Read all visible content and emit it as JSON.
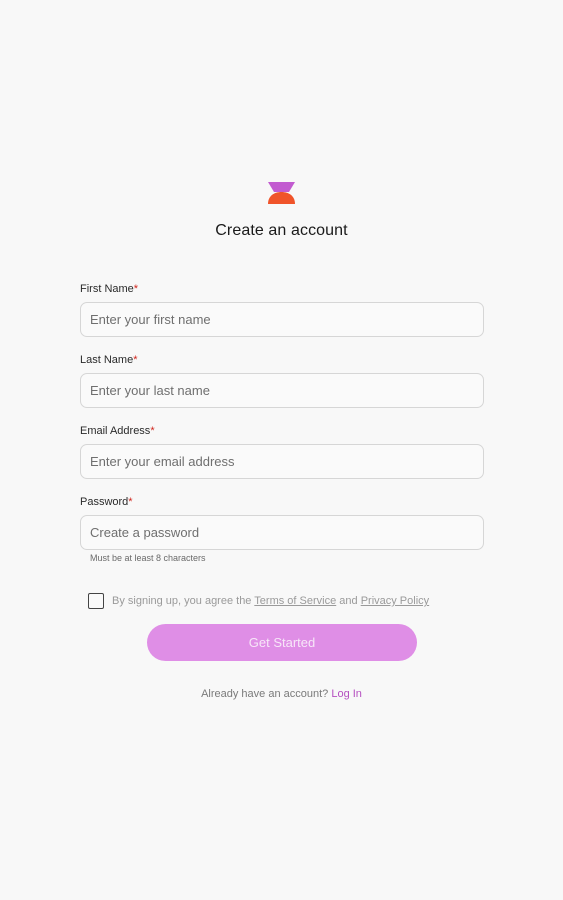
{
  "header": {
    "title": "Create an account"
  },
  "colors": {
    "logo_top": "#c25bd0",
    "logo_bottom": "#f0542a",
    "button_bg": "#df8ee6",
    "link": "#b54fc0",
    "required_asterisk": "#d0261d"
  },
  "form": {
    "first_name": {
      "label": "First Name",
      "required": "*",
      "placeholder": "Enter your first name"
    },
    "last_name": {
      "label": "Last Name",
      "required": "*",
      "placeholder": "Enter your last name"
    },
    "email": {
      "label": "Email Address",
      "required": "*",
      "placeholder": "Enter your email address"
    },
    "password": {
      "label": "Password",
      "required": "*",
      "placeholder": "Create a password",
      "hint": "Must be at least 8 characters"
    },
    "agree": {
      "prefix": "By signing up, you agree the ",
      "terms_link": "Terms of Service",
      "middle": " and ",
      "privacy_link": "Privacy Policy"
    },
    "submit_label": "Get Started"
  },
  "footer": {
    "prompt": "Already have an account? ",
    "login_link": "Log In"
  }
}
